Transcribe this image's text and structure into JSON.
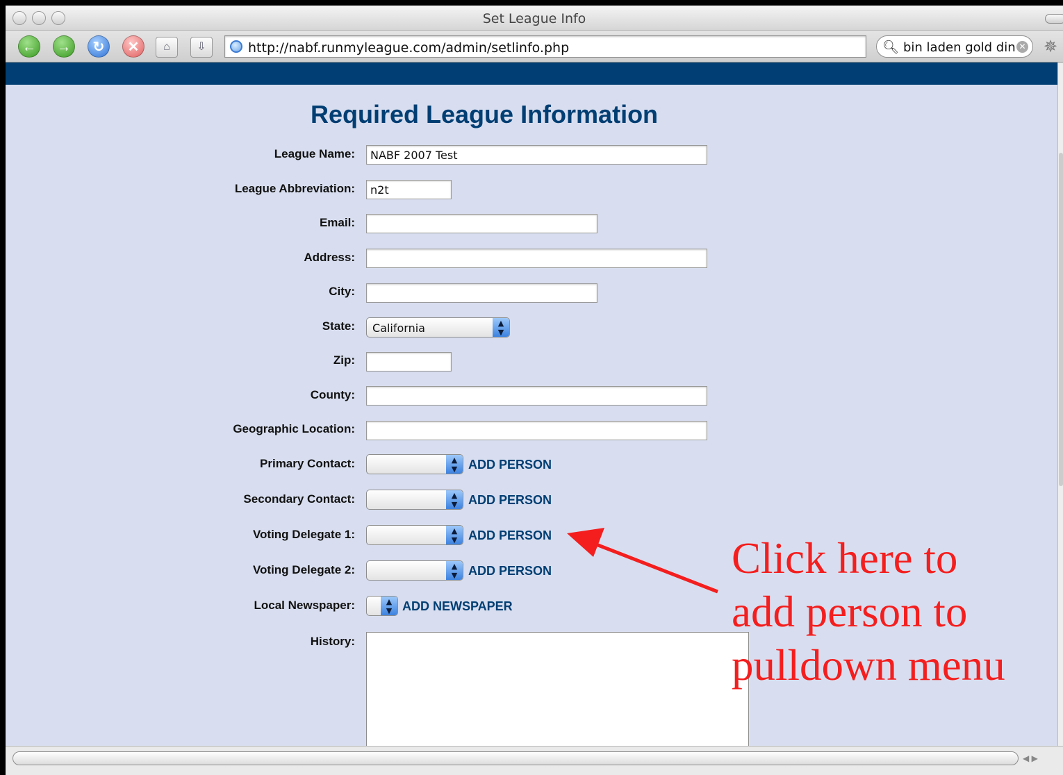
{
  "window": {
    "title": "Set League Info"
  },
  "toolbar": {
    "url": "http://nabf.runmyleague.com/admin/setlinfo.php",
    "search_value": "bin laden gold din"
  },
  "form": {
    "title": "Required League Information",
    "fields": {
      "league_name": {
        "label": "League Name:",
        "value": "NABF 2007 Test"
      },
      "league_abbreviation": {
        "label": "League Abbreviation:",
        "value": "n2t"
      },
      "email": {
        "label": "Email:",
        "value": ""
      },
      "address": {
        "label": "Address:",
        "value": ""
      },
      "city": {
        "label": "City:",
        "value": ""
      },
      "state": {
        "label": "State:",
        "value": "California"
      },
      "zip": {
        "label": "Zip:",
        "value": ""
      },
      "county": {
        "label": "County:",
        "value": ""
      },
      "geographic_location": {
        "label": "Geographic Location:",
        "value": ""
      },
      "primary_contact": {
        "label": "Primary Contact:",
        "value": "",
        "link": "ADD PERSON"
      },
      "secondary_contact": {
        "label": "Secondary Contact:",
        "value": "",
        "link": "ADD PERSON"
      },
      "voting_delegate_1": {
        "label": "Voting Delegate 1:",
        "value": "",
        "link": "ADD PERSON"
      },
      "voting_delegate_2": {
        "label": "Voting Delegate 2:",
        "value": "",
        "link": "ADD PERSON"
      },
      "local_newspaper": {
        "label": "Local Newspaper:",
        "value": "",
        "link": "ADD NEWSPAPER"
      },
      "history": {
        "label": "History:",
        "value": ""
      }
    }
  },
  "annotation": {
    "lines": [
      "Click here to",
      "add person to",
      "pulldown menu"
    ],
    "color": "#f41e1e"
  },
  "colors": {
    "header_band": "#003e73",
    "page_bg": "#d8deef",
    "link": "#003e73"
  },
  "icons": [
    "back-icon",
    "forward-icon",
    "reload-icon",
    "stop-icon",
    "home-icon",
    "download-icon",
    "globe-icon",
    "search-icon",
    "clear-icon",
    "spinner-icon"
  ]
}
